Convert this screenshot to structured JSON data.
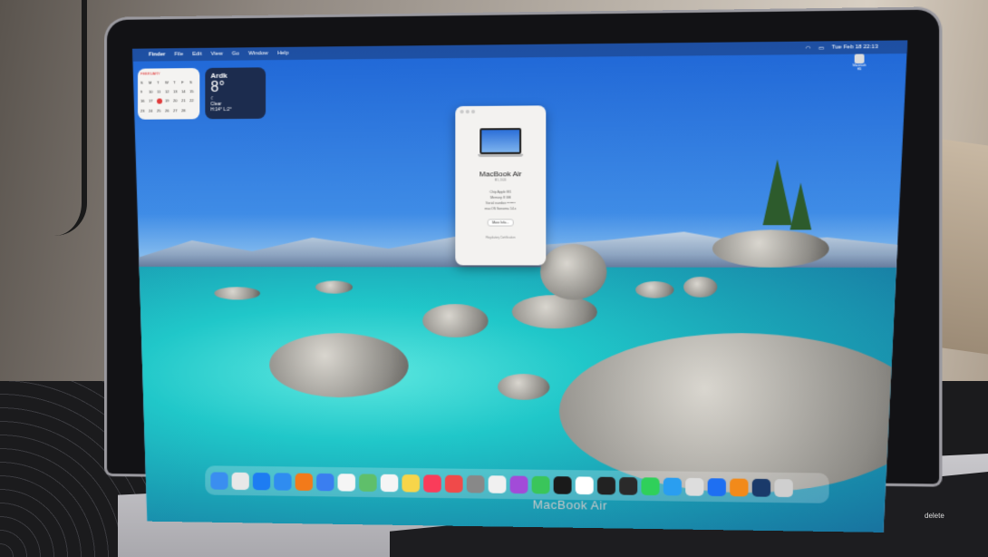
{
  "menubar": {
    "items": [
      "Finder",
      "File",
      "Edit",
      "View",
      "Go",
      "Window",
      "Help"
    ],
    "clock": "Tue Feb 18 22:13"
  },
  "calendar_widget": {
    "month": "FEBRUARY",
    "highlight_day": "18"
  },
  "weather_widget": {
    "city": "Ardk",
    "temperature": "8°",
    "condition": "Clear",
    "range": "H:14° L:2°"
  },
  "about_window": {
    "title": "MacBook Air",
    "subtitle": "M1, 2020",
    "specs": [
      "Chip   Apple M1",
      "Memory   8 GB",
      "Serial number   •••••••",
      "macOS   Sonoma 14.x"
    ],
    "more_info_label": "More Info...",
    "footer": "Regulatory Certification"
  },
  "desktop_disk": {
    "label": "Macintosh HD"
  },
  "bezel": {
    "label": "MacBook Air"
  },
  "keyboard": {
    "delete_label": "delete"
  },
  "dock": {
    "apps": [
      "finder",
      "launchpad",
      "app-store",
      "safari",
      "firefox",
      "mail",
      "photos",
      "maps",
      "reminders",
      "notes",
      "music",
      "news",
      "calculator",
      "chess",
      "podcasts",
      "facetime",
      "quicktime",
      "calendar",
      "terminal",
      "activity-monitor",
      "whatsapp",
      "telegram",
      "screenshot",
      "keynote",
      "vlc",
      "steam",
      "trash"
    ]
  },
  "colors": {
    "sky": "#1f66d6",
    "water": "#20c7c9",
    "menubar": "#1e3c78"
  }
}
